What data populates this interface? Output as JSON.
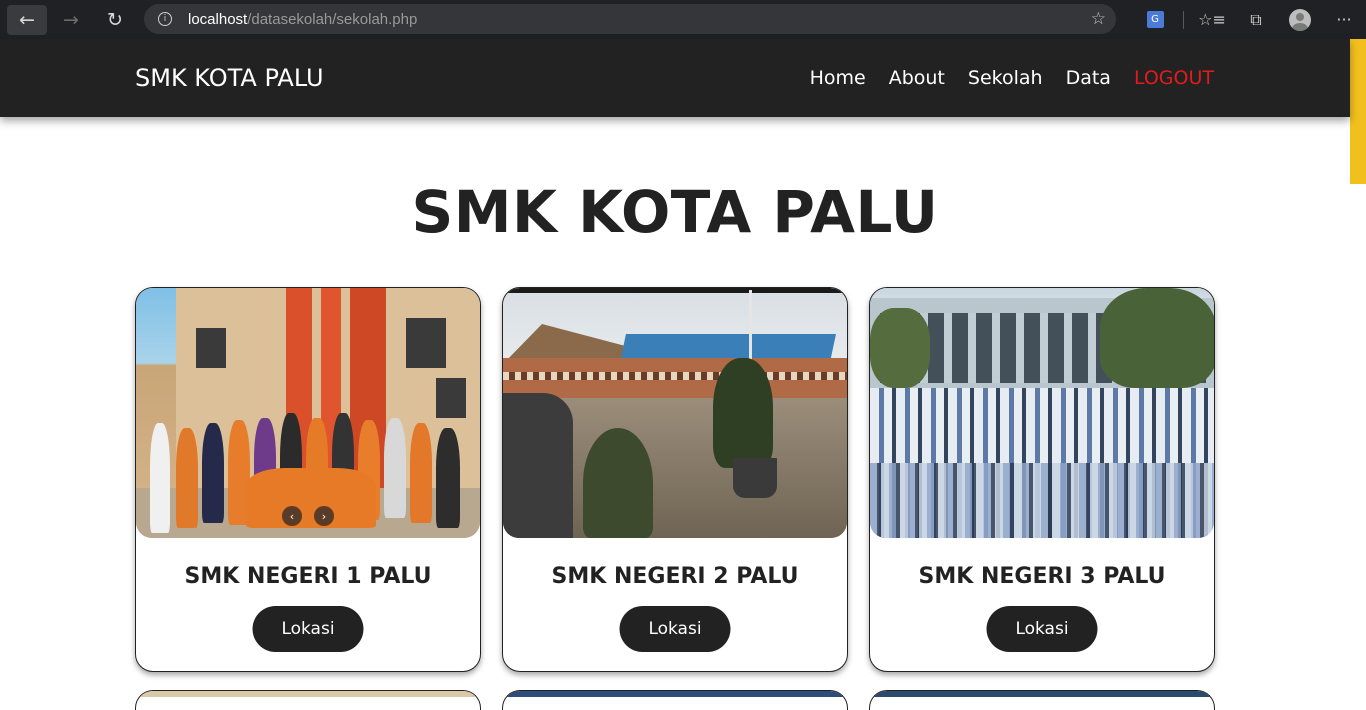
{
  "browser": {
    "url_host": "localhost",
    "url_path": "/datasekolah/sekolah.php"
  },
  "navbar": {
    "brand": "SMK KOTA PALU",
    "menu": [
      {
        "label": "Home"
      },
      {
        "label": "About"
      },
      {
        "label": "Sekolah"
      },
      {
        "label": "Data"
      },
      {
        "label": "LOGOUT",
        "color": "#e11c1c"
      }
    ]
  },
  "main": {
    "title": "SMK KOTA PALU",
    "cards": [
      {
        "name": "SMK NEGERI 1 PALU",
        "button": "Lokasi"
      },
      {
        "name": "SMK NEGERI 2 PALU",
        "button": "Lokasi"
      },
      {
        "name": "SMK NEGERI 3 PALU",
        "button": "Lokasi"
      }
    ]
  },
  "colors": {
    "navbar_bg": "#222222",
    "logout": "#e11c1c",
    "button_bg": "#222222",
    "scroll_thumb": "#f2c01e"
  }
}
